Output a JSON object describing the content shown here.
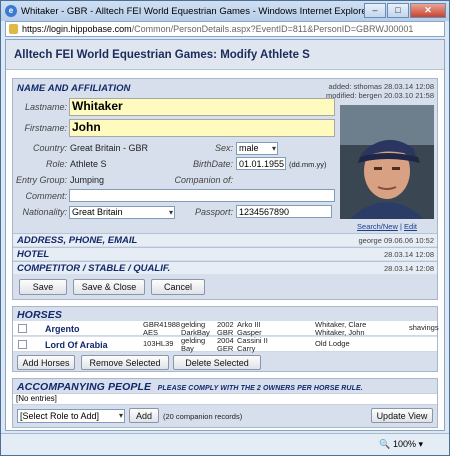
{
  "window": {
    "title": "Whitaker - GBR - Alltech FEI World Equestrian Games - Windows Internet Explorer",
    "url_host": "https://login.hippobase.com",
    "url_path": "/Common/PersonDetails.aspx?EventID=811&PersonID=GBRWJ00001",
    "zoom": "100%",
    "controls": {
      "minimize": "–",
      "maximize": "□",
      "close": "✕"
    }
  },
  "page": {
    "title": "Alltech FEI World Equestrian Games: Modify Athlete S"
  },
  "name_section": {
    "header": "Name and Affiliation",
    "added": "added: sthomas 28.03.14 12:08",
    "modified": "modified: bergen 20.03.10 21:58",
    "lastname_label": "Lastname:",
    "lastname": "Whitaker",
    "firstname_label": "Firstname:",
    "firstname": "John",
    "country_label": "Country:",
    "country": "Great Britain - GBR",
    "sex_label": "Sex:",
    "sex": "male",
    "role_label": "Role:",
    "role": "Athlete S",
    "birthdate_label": "BirthDate:",
    "birthdate": "01.01.1955",
    "birthdate_hint": "(dd.mm.yy)",
    "entry_group_label": "Entry Group:",
    "entry_group": "Jumping",
    "companion_label": "Companion of:",
    "comment_label": "Comment:",
    "comment": "",
    "nationality_label": "Nationality:",
    "nationality": "Great Britain",
    "passport_label": "Passport:",
    "passport": "1234567890",
    "photo_links": {
      "search_new": "Search/New",
      "sep": "|",
      "edit": "Edit"
    }
  },
  "collapsed_rows": [
    {
      "title": "Address, Phone, Email",
      "meta": "george 09.06.06 10:52"
    },
    {
      "title": "Hotel",
      "meta": "28.03.14 12:08"
    },
    {
      "title": "Competitor / Stable / Qualif.",
      "meta": "28.03.14 12:08"
    }
  ],
  "form_buttons": {
    "save": "Save",
    "save_close": "Save & Close",
    "cancel": "Cancel"
  },
  "horses": {
    "header": "Horses",
    "rows": [
      {
        "name": "Argento",
        "id": "GBR41988",
        "id2": "AES",
        "sex": "gelding",
        "color": "DarkBay",
        "year": "2002",
        "breed": "GBR",
        "sire": "Arko III",
        "dam": "Gasper",
        "owner1": "Whitaker, Clare",
        "owner2": "Whitaker, John",
        "extra": "shavings"
      },
      {
        "name": "Lord Of Arabia",
        "id": "103HL39",
        "id2": "",
        "sex": "gelding",
        "color": "Bay",
        "year": "2004",
        "breed": "GER",
        "sire": "Cassini II",
        "dam": "Carry",
        "owner1": "Old Lodge",
        "owner2": "",
        "extra": ""
      }
    ],
    "buttons": {
      "add": "Add Horses",
      "remove": "Remove Selected",
      "delete": "Delete Selected"
    }
  },
  "accompanying": {
    "header": "Accompanying People",
    "note": "please comply with the 2 owners per horse rule.",
    "empty": "[No entries]",
    "role_select": "[Select Role to Add]",
    "add": "Add",
    "count": "(20 companion records)",
    "update": "Update View"
  }
}
